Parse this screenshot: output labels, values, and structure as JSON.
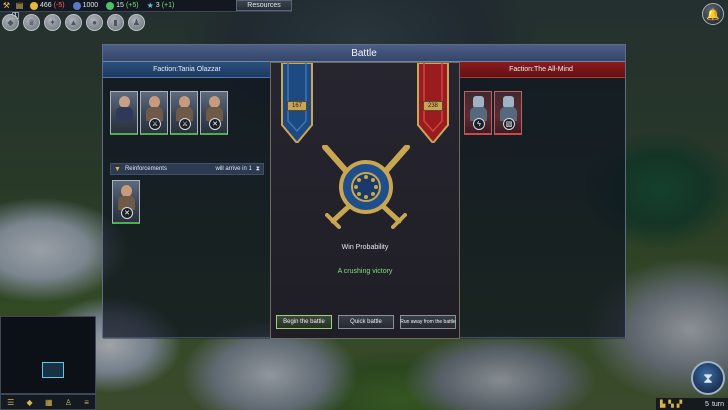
{
  "topbar": {
    "gold": "466",
    "gold_delta": "(-5)",
    "science": "1000",
    "growth": "15",
    "growth_delta": "(+5)",
    "influence": "3",
    "influence_delta": "(+1)",
    "resources_label": "Resources",
    "notification_count": "1"
  },
  "battle": {
    "title": "Battle",
    "left_faction": "Faction:Tania Olazzar",
    "right_faction": "Faction:The All-Mind",
    "reinforcements_label": "Reinforcements",
    "reinforcements_arrival": "will arrive in 1",
    "left_strength": "167",
    "right_strength": "238",
    "win_probability_label": "Win Probability",
    "verdict": "A crushing victory",
    "begin_button": "Begin the battle",
    "quick_button": "Quick battle",
    "run_button": "Run away from the battle"
  },
  "turn": {
    "number": "5",
    "label": "turn"
  },
  "colors": {
    "ally": "#2b4f7d",
    "enemy": "#8a1b1f",
    "verdict": "#7fe07a"
  }
}
